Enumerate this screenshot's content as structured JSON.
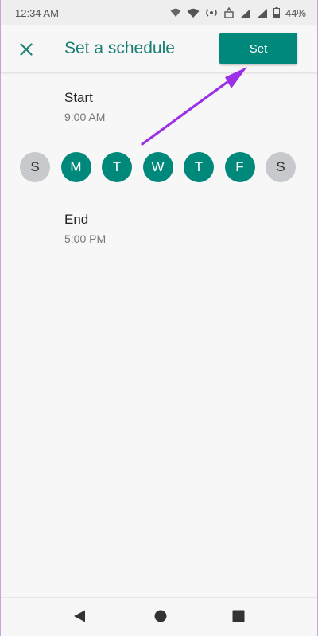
{
  "status_bar": {
    "time": "12:34 AM",
    "battery": "44%",
    "icons": [
      "wifi-icon",
      "hotspot-icon",
      "signal-icon",
      "signal-icon",
      "battery-icon"
    ]
  },
  "header": {
    "close_icon": "close-icon",
    "title": "Set a schedule",
    "set_label": "Set"
  },
  "start": {
    "label": "Start",
    "time": "9:00 AM"
  },
  "days": [
    {
      "letter": "S",
      "selected": false
    },
    {
      "letter": "M",
      "selected": true
    },
    {
      "letter": "T",
      "selected": true
    },
    {
      "letter": "W",
      "selected": true
    },
    {
      "letter": "T",
      "selected": true
    },
    {
      "letter": "F",
      "selected": true
    },
    {
      "letter": "S",
      "selected": false
    }
  ],
  "end": {
    "label": "End",
    "time": "5:00 PM"
  },
  "colors": {
    "accent": "#00897b",
    "title": "#1a7f72",
    "day_off": "#c8c9cc",
    "annotation_arrow": "#9b30e8"
  },
  "nav_bar": {
    "icons": [
      "back-icon",
      "home-icon",
      "recents-icon"
    ]
  }
}
